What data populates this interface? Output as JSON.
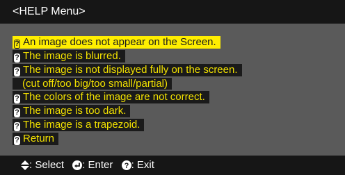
{
  "header": {
    "title": "<HELP Menu>"
  },
  "menu": {
    "items": [
      {
        "label": "An image does not appear on the Screen."
      },
      {
        "label": "The image is blurred."
      },
      {
        "label": "The image is not displayed fully on the screen.",
        "continuation": "(cut off/too big/too small/partial)"
      },
      {
        "label": "The colors of the image are not correct."
      },
      {
        "label": "The image is too dark."
      },
      {
        "label": "The image is a trapezoid."
      },
      {
        "label": "Return"
      }
    ],
    "selected_index": 0
  },
  "footer": {
    "select_label": ": Select",
    "enter_label": ": Enter",
    "exit_label": ": Exit"
  },
  "colors": {
    "text_yellow": "#f2e100",
    "highlight": "#ffee00",
    "bar_bg": "#161616",
    "screen_bg": "#5a5a5a"
  }
}
